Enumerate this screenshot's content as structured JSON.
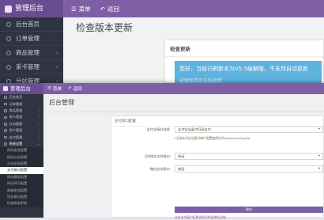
{
  "back_window": {
    "brand": "管理后台",
    "nav": {
      "menu_label": "菜单",
      "back_label": "返回"
    },
    "sidebar": [
      {
        "label": "后台首页",
        "has_children": false
      },
      {
        "label": "订单管理",
        "has_children": false
      },
      {
        "label": "商品管理",
        "has_children": true
      },
      {
        "label": "采卡管理",
        "has_children": true
      },
      {
        "label": "分站管理",
        "has_children": true
      }
    ],
    "page_title": "检查版本更新",
    "panel": {
      "heading": "检查更新",
      "alert_text": "您好，当前已刷新本为V5.5破解版，不支持自动更新",
      "alert_sub": "破解版请勿在线更新"
    }
  },
  "front_window": {
    "brand": "管理后台",
    "nav": {
      "menu_label": "菜单",
      "back_label": "返回"
    },
    "page_title": "后台管理",
    "sidebar": [
      {
        "label": "后台首页",
        "type": "item"
      },
      {
        "label": "订单管理",
        "type": "item"
      },
      {
        "label": "商品管理",
        "type": "item",
        "has_children": true
      },
      {
        "label": "采卡管理",
        "type": "item",
        "has_children": true
      },
      {
        "label": "分站管理",
        "type": "item",
        "has_children": true
      },
      {
        "label": "用户管理",
        "type": "item",
        "has_children": true
      },
      {
        "label": "支付管理",
        "type": "item",
        "has_children": true
      },
      {
        "label": "系统设置",
        "type": "open",
        "has_children": true
      },
      {
        "label": "网站信息配置",
        "type": "sub"
      },
      {
        "label": "网站公告配置",
        "type": "sub"
      },
      {
        "label": "分站信息配置",
        "type": "sub"
      },
      {
        "label": "支付接口配置",
        "type": "active"
      },
      {
        "label": "网站模板配置",
        "type": "sub"
      },
      {
        "label": "网站SEO配置",
        "type": "sub"
      },
      {
        "label": "邮箱发信配置",
        "type": "sub"
      },
      {
        "label": "短信接口配置",
        "type": "sub"
      },
      {
        "label": "检查版本更新",
        "type": "sub"
      }
    ],
    "form": {
      "heading": "支付接口配置",
      "rows": [
        {
          "label": "支付宝接口选择",
          "value": "支付宝当面付扫码支付"
        },
        {
          "label": "QQ钱包支付接口",
          "value": "关闭"
        },
        {
          "label": "微信支付接口",
          "value": "关闭"
        }
      ],
      "note": "*当前支付宝当面付商户配置使用文件/other/config.php",
      "save_label": "保存",
      "tip_link": "点击支付接口设置说明及申请地址说明"
    }
  },
  "colors": {
    "accent": "#7e5fa6",
    "sidebar_bg": "#2f3440",
    "alert_bg": "#5fb1de"
  }
}
